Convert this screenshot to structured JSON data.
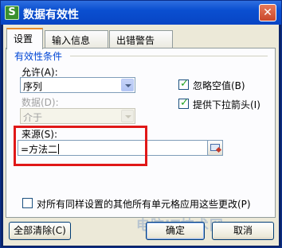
{
  "window": {
    "title": "数据有效性",
    "app_icon_letter": "S",
    "close_symbol": "✕"
  },
  "tabs": [
    {
      "label": "设置",
      "active": true
    },
    {
      "label": "输入信息",
      "active": false
    },
    {
      "label": "出错警告",
      "active": false
    }
  ],
  "validation": {
    "group_title": "有效性条件",
    "allow_label": "允许(A):",
    "allow_value": "序列",
    "data_label": "数据(D):",
    "data_value": "介于",
    "ignore_blank_label": "忽略空值(B)",
    "ignore_blank_checked": true,
    "dropdown_label": "提供下拉箭头(I)",
    "dropdown_checked": true,
    "source_label": "来源(S):",
    "source_value": "=方法二"
  },
  "apply_all": {
    "label": "对所有同样设置的其他所有单元格应用这些更改(P)",
    "checked": false
  },
  "buttons": {
    "clear_all": "全部清除(C)",
    "ok": "确定",
    "cancel": "取消"
  },
  "watermark": "电脑IT技术网",
  "colors": {
    "title_bar": "#0a4fd0",
    "highlight": "#e01818",
    "group_title": "#0046d5",
    "active_tab_accent": "#e68b2c"
  }
}
